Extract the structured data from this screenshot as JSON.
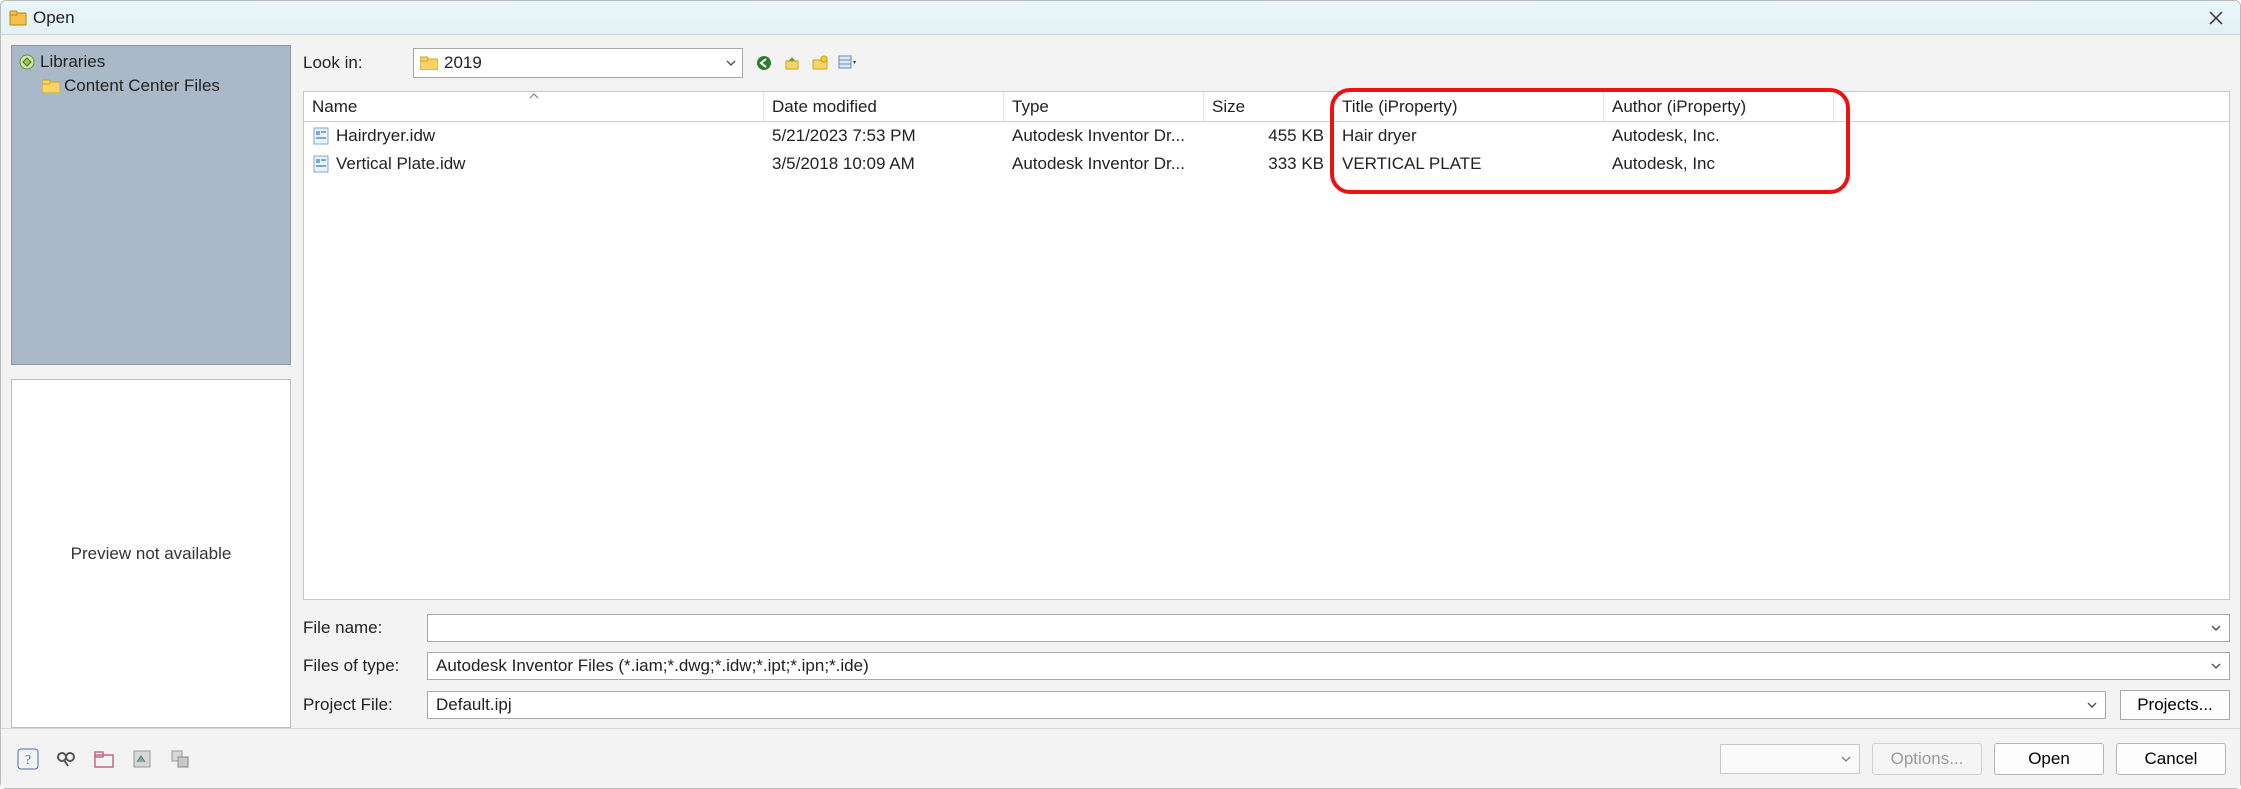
{
  "window": {
    "title": "Open"
  },
  "sidebar": {
    "root_label": "Libraries",
    "child_label": "Content Center Files"
  },
  "preview": {
    "text": "Preview not available"
  },
  "lookin": {
    "label": "Look in:",
    "value": "2019"
  },
  "columns": {
    "name": "Name",
    "date": "Date modified",
    "type": "Type",
    "size": "Size",
    "title": "Title (iProperty)",
    "author": "Author (iProperty)"
  },
  "files": [
    {
      "name": "Hairdryer.idw",
      "date": "5/21/2023 7:53 PM",
      "type": "Autodesk Inventor Dr...",
      "size": "455 KB",
      "title": "Hair dryer",
      "author": "Autodesk, Inc."
    },
    {
      "name": "Vertical Plate.idw",
      "date": "3/5/2018 10:09 AM",
      "type": "Autodesk Inventor Dr...",
      "size": "333 KB",
      "title": "VERTICAL PLATE",
      "author": "Autodesk, Inc"
    }
  ],
  "form": {
    "filename_label": "File name:",
    "filename_value": "",
    "filetype_label": "Files of type:",
    "filetype_value": "Autodesk Inventor Files (*.iam;*.dwg;*.idw;*.ipt;*.ipn;*.ide)",
    "project_label": "Project File:",
    "project_value": "Default.ipj",
    "projects_button": "Projects..."
  },
  "footer": {
    "options": "Options...",
    "open": "Open",
    "cancel": "Cancel"
  }
}
